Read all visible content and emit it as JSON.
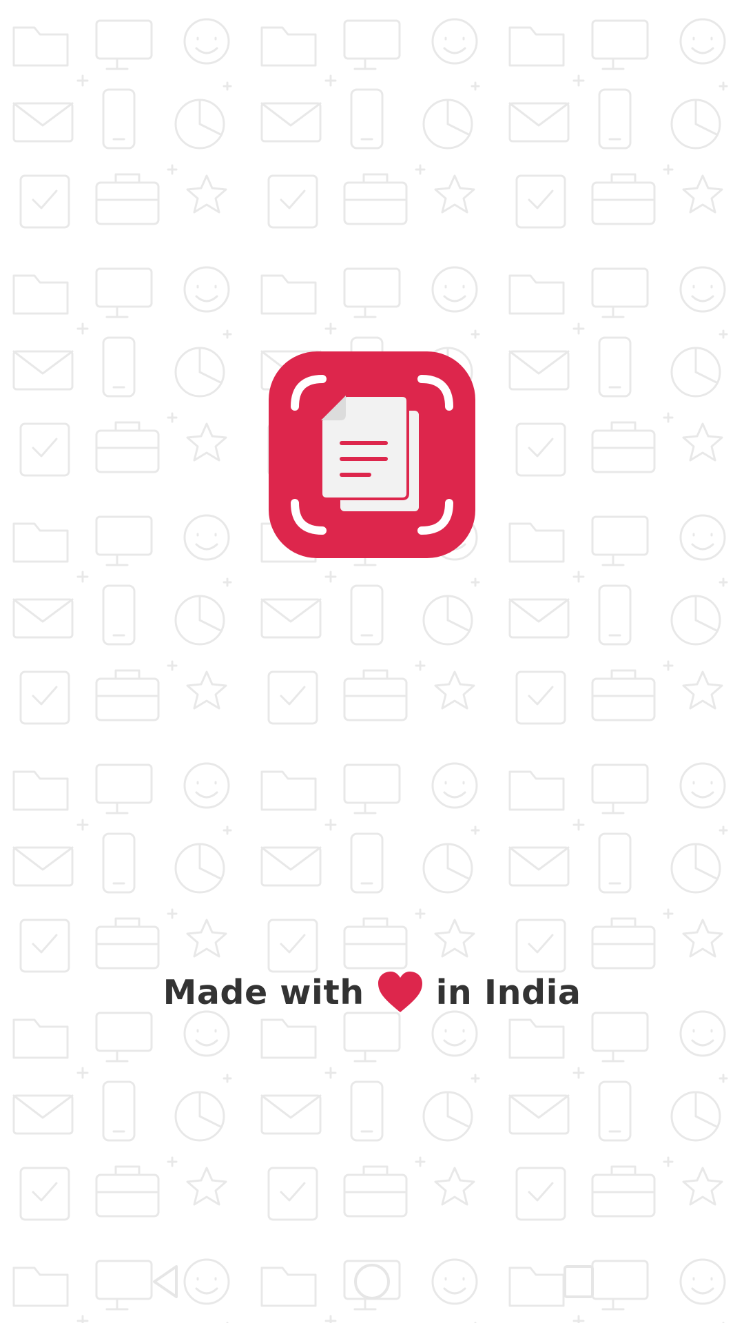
{
  "splash": {
    "tagline_before": "Made with",
    "tagline_after": "in India",
    "accent_color": "#dd264c",
    "text_color": "#333333",
    "logo_icon": "document-scanner-icon",
    "heart_icon": "heart-icon"
  },
  "system_nav": {
    "back_icon": "back-triangle-icon",
    "home_icon": "home-circle-icon",
    "recents_icon": "recents-square-icon"
  }
}
